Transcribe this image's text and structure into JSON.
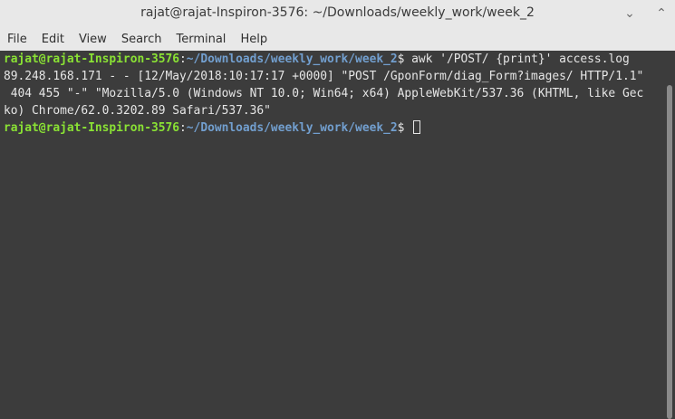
{
  "window": {
    "title": "rajat@rajat-Inspiron-3576: ~/Downloads/weekly_work/week_2",
    "minimize_glyph": "⌄",
    "maximize_glyph": "⌃"
  },
  "menu": {
    "items": [
      "File",
      "Edit",
      "View",
      "Search",
      "Terminal",
      "Help"
    ]
  },
  "terminal": {
    "prompt_user": "rajat@rajat-Inspiron-3576",
    "prompt_colon": ":",
    "prompt_path": "~/Downloads/weekly_work/week_2",
    "prompt_symbol": "$",
    "command": " awk '/POST/ {print}' access.log",
    "output_lines": [
      "89.248.168.171 - - [12/May/2018:10:17:17 +0000] \"POST /GponForm/diag_Form?images/ HTTP/1.1\"",
      " 404 455 \"-\" \"Mozilla/5.0 (Windows NT 10.0; Win64; x64) AppleWebKit/537.36 (KHTML, like Gec",
      "ko) Chrome/62.0.3202.89 Safari/537.36\""
    ]
  },
  "colors": {
    "user": "#8ae234",
    "path": "#729fcf",
    "background": "#3c3c3c",
    "text": "#e6e6e6"
  }
}
